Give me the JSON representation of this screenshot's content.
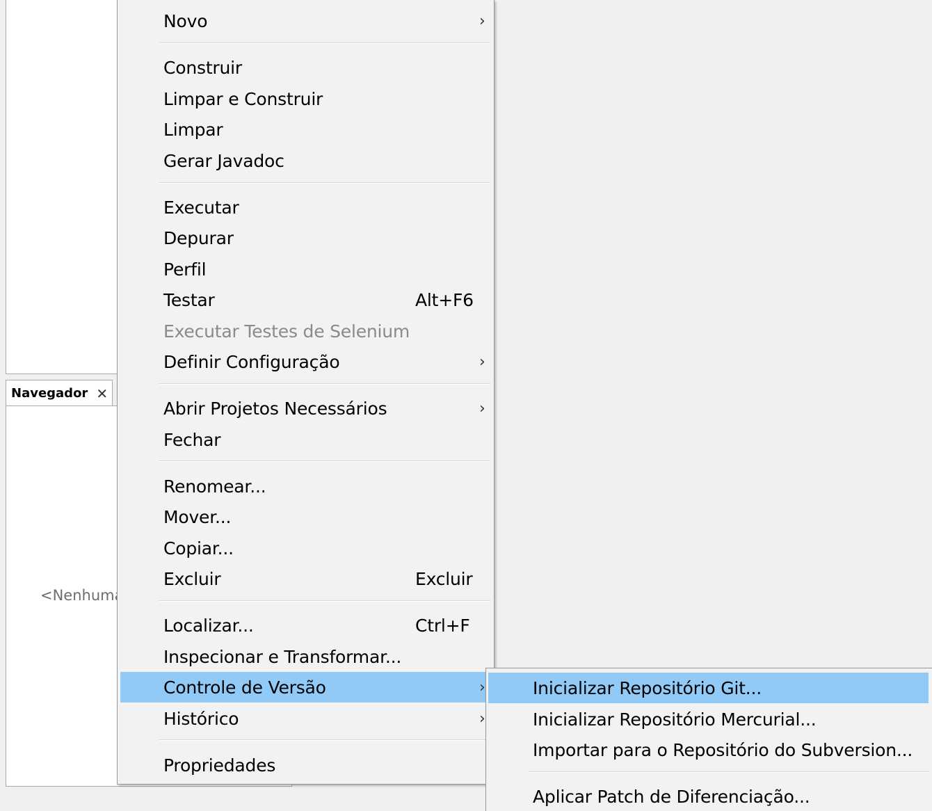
{
  "navigator": {
    "tab_label": "Navegador",
    "close_glyph": "✕",
    "empty_text": "<Nenhuma"
  },
  "menu": {
    "chevron_glyph": "›",
    "items": [
      {
        "label": "Novo",
        "shortcut": "",
        "submenu": true
      },
      {
        "label": "Construir",
        "shortcut": "",
        "submenu": false
      },
      {
        "label": "Limpar e Construir",
        "shortcut": "",
        "submenu": false
      },
      {
        "label": "Limpar",
        "shortcut": "",
        "submenu": false
      },
      {
        "label": "Gerar Javadoc",
        "shortcut": "",
        "submenu": false
      },
      {
        "label": "Executar",
        "shortcut": "",
        "submenu": false
      },
      {
        "label": "Depurar",
        "shortcut": "",
        "submenu": false
      },
      {
        "label": "Perfil",
        "shortcut": "",
        "submenu": false
      },
      {
        "label": "Testar",
        "shortcut": "Alt+F6",
        "submenu": false
      },
      {
        "label": "Executar Testes de Selenium",
        "shortcut": "",
        "submenu": false,
        "disabled": true
      },
      {
        "label": "Definir Configuração",
        "shortcut": "",
        "submenu": true
      },
      {
        "label": "Abrir Projetos Necessários",
        "shortcut": "",
        "submenu": true
      },
      {
        "label": "Fechar",
        "shortcut": "",
        "submenu": false
      },
      {
        "label": "Renomear...",
        "shortcut": "",
        "submenu": false
      },
      {
        "label": "Mover...",
        "shortcut": "",
        "submenu": false
      },
      {
        "label": "Copiar...",
        "shortcut": "",
        "submenu": false
      },
      {
        "label": "Excluir",
        "shortcut": "Excluir",
        "submenu": false
      },
      {
        "label": "Localizar...",
        "shortcut": "Ctrl+F",
        "submenu": false
      },
      {
        "label": "Inspecionar e Transformar...",
        "shortcut": "",
        "submenu": false
      },
      {
        "label": "Controle de Versão",
        "shortcut": "",
        "submenu": true,
        "highlighted": true
      },
      {
        "label": "Histórico",
        "shortcut": "",
        "submenu": true
      },
      {
        "label": "Propriedades",
        "shortcut": "",
        "submenu": false
      }
    ]
  },
  "submenu": {
    "items": [
      {
        "label": "Inicializar Repositório Git...",
        "highlighted": true
      },
      {
        "label": "Inicializar Repositório Mercurial..."
      },
      {
        "label": "Importar para o Repositório do Subversion..."
      },
      {
        "label": "Aplicar Patch de Diferenciação..."
      }
    ]
  },
  "colors": {
    "highlight": "#91c9f7",
    "menu_bg": "#f2f2f2",
    "disabled_text": "#8a8a8a"
  }
}
